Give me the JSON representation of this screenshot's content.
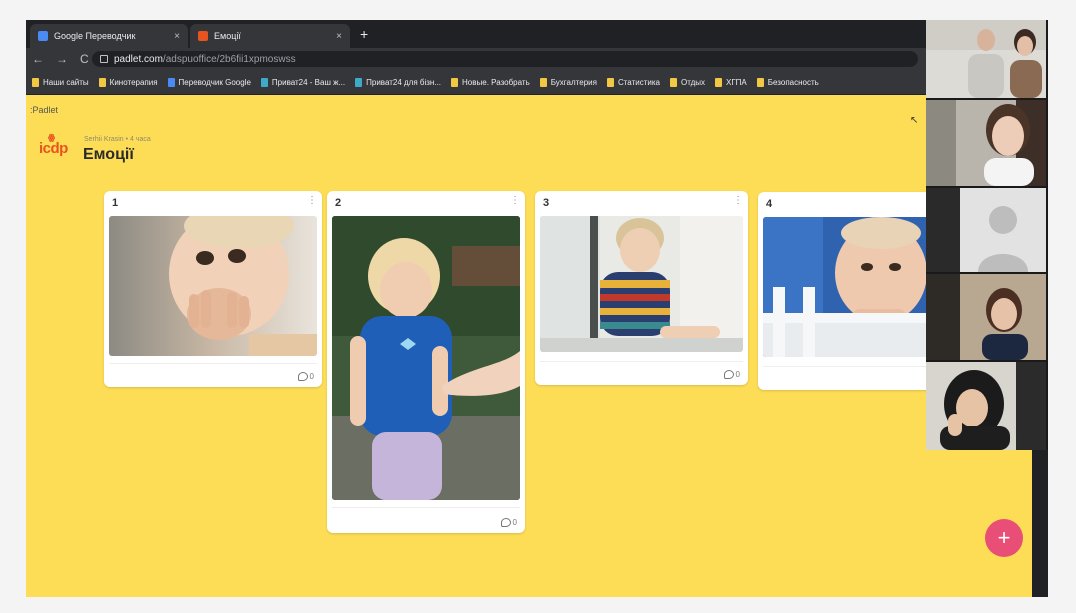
{
  "browser": {
    "tabs": [
      {
        "title": "Google Переводчик",
        "close": "×"
      },
      {
        "title": "Емоції",
        "close": "×"
      }
    ],
    "new_tab": "+",
    "nav": {
      "back": "←",
      "forward": "→",
      "reload": "C"
    },
    "url_domain": "padlet.com",
    "url_path": "/adspuoffice/2b6fii1xpmoswss"
  },
  "bookmarks": [
    "Наши сайты",
    "Кинотерапия",
    "Переводчик Google",
    "Приват24 - Ваш ж...",
    "Приват24 для бізн...",
    "Новые. Разобрать",
    "Бухгалтерия",
    "Статистика",
    "Отдых",
    "ХГПА",
    "Безопасность"
  ],
  "padlet": {
    "brand": ":Padlet",
    "author": "Serhii Krasin • 4 часа",
    "org_logo": "icdp",
    "title": "Емоції",
    "fab": "+",
    "cards": [
      {
        "number": "1",
        "comments": "0",
        "menu": "⋮"
      },
      {
        "number": "2",
        "comments": "0",
        "menu": "⋮"
      },
      {
        "number": "3",
        "comments": "0",
        "menu": "⋮"
      },
      {
        "number": "4",
        "comments": "",
        "menu": ""
      }
    ]
  },
  "colors": {
    "padlet_bg": "#fddd55",
    "fab": "#e94e77",
    "brand_orange": "#e8541f"
  }
}
